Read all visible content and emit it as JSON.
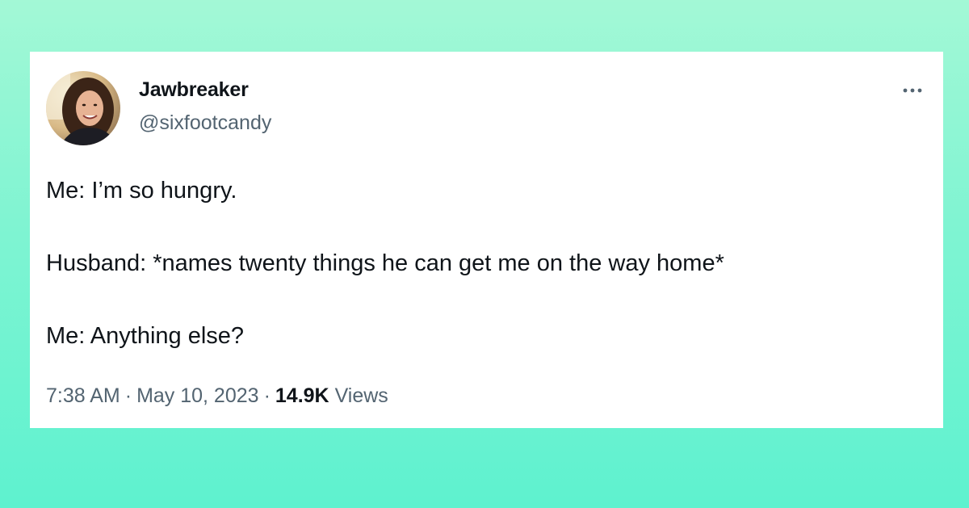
{
  "background": {
    "gradient_top": "#a3f8d6",
    "gradient_bottom": "#5ef2cf"
  },
  "tweet": {
    "author": {
      "display_name": "Jawbreaker",
      "handle": "@sixfootcandy",
      "avatar_icon": "profile-photo"
    },
    "more_icon": "more-horizontal-icon",
    "body_lines": [
      "Me: I’m so hungry.",
      "Husband: *names twenty things he can get me on the way home*",
      "Me: Anything else?"
    ],
    "meta": {
      "time": "7:38 AM",
      "separator": "·",
      "date": "May 10, 2023",
      "views_count": "14.9K",
      "views_label": "Views"
    },
    "colors": {
      "text_primary": "#0f1419",
      "text_secondary": "#536471",
      "card_background": "#ffffff"
    }
  }
}
